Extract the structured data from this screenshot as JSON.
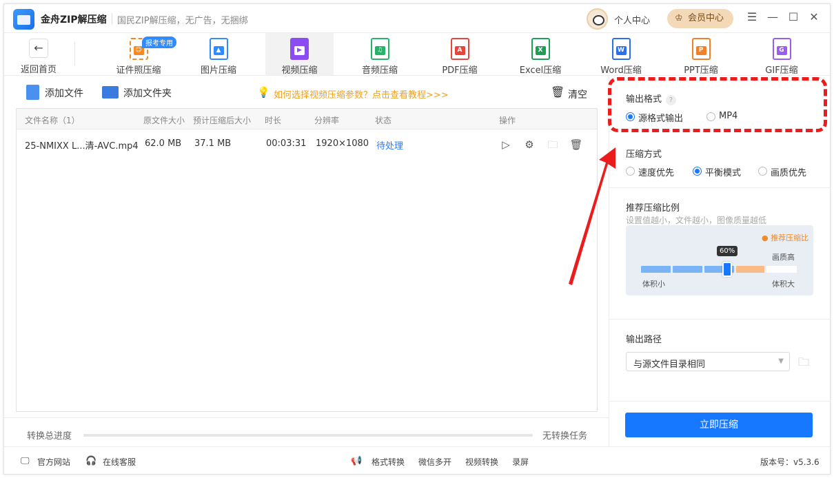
{
  "app": {
    "name": "金舟ZIP解压缩",
    "slogan": "国民ZIP解压缩，无广告，无捆绑",
    "user_center": "个人中心",
    "vip_center": "会员中心"
  },
  "window": {
    "menu": "☰",
    "min": "—",
    "max": "☐",
    "close": "✕"
  },
  "toolbar": {
    "back": "返回首页",
    "tools": [
      {
        "label": "证件照压缩",
        "badge": "报考专用",
        "color": "#f08a24"
      },
      {
        "label": "图片压缩",
        "color": "#2f8bff"
      },
      {
        "label": "视频压缩",
        "color": "#8a4df0",
        "active": true
      },
      {
        "label": "音频压缩",
        "color": "#27b36b"
      },
      {
        "label": "PDF压缩",
        "color": "#e8453c"
      },
      {
        "label": "Excel压缩",
        "color": "#1f9e55"
      },
      {
        "label": "Word压缩",
        "color": "#2b6ff0"
      },
      {
        "label": "PPT压缩",
        "color": "#f0812a"
      },
      {
        "label": "GIF压缩",
        "color": "#9b5cf0"
      }
    ]
  },
  "actions": {
    "add_file": "添加文件",
    "add_folder": "添加文件夹",
    "tip": "如何选择视频压缩参数？点击查看教程>>>",
    "clear": "清空"
  },
  "table": {
    "headers": [
      "文件名称（1）",
      "原文件大小",
      "预计压缩后大小",
      "时长",
      "分辨率",
      "状态",
      "操作"
    ],
    "rows": [
      {
        "name": "25-NMIXX L...清-AVC.mp4",
        "size": "62.0 MB",
        "est": "37.1 MB",
        "duration": "00:03:31",
        "resolution": "1920×1080",
        "status": "待处理"
      }
    ]
  },
  "progress": {
    "label": "转换总进度",
    "status": "无转换任务"
  },
  "settings": {
    "output_format": {
      "title": "输出格式",
      "help": "?",
      "options": [
        "源格式输出",
        "MP4"
      ],
      "selected": "源格式输出"
    },
    "compress_mode": {
      "title": "压缩方式",
      "options": [
        "速度优先",
        "平衡模式",
        "画质优先"
      ],
      "selected": "平衡模式"
    },
    "ratio": {
      "title": "推荐压缩比例",
      "hint": "设置值越小，文件越小，图像质量越低",
      "recommend": "● 推荐压缩比",
      "high_quality": "画质高",
      "value": "60%",
      "level": 0.6,
      "small": "体积小",
      "large": "体积大"
    },
    "output_path": {
      "title": "输出路径",
      "value": "与源文件目录相同"
    },
    "start": "立即压缩"
  },
  "footer": {
    "website": "官方网站",
    "service": "在线客服",
    "links": [
      "格式转换",
      "微信多开",
      "视频转换",
      "录屏"
    ],
    "version": "版本号：v5.3.6"
  }
}
